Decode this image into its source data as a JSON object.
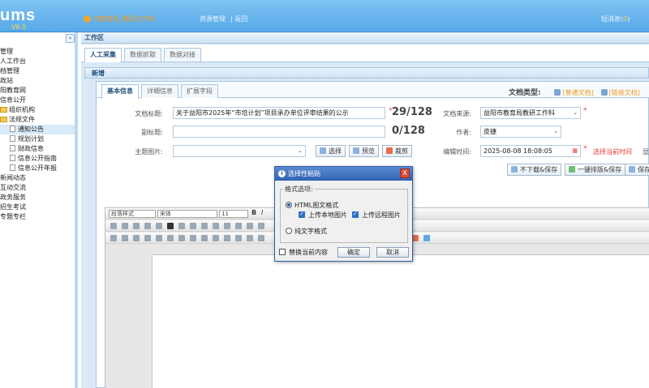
{
  "header": {
    "logo": "ums",
    "version": "V6.0",
    "user": "市教育局_教研工作科",
    "nav": [
      "资源管理",
      "返回"
    ],
    "msg_label": "短消息(",
    "msg_count": "0",
    "msg_close": ")"
  },
  "sidebar": {
    "collapse": "«",
    "items": [
      {
        "label": "管理",
        "type": "text"
      },
      {
        "label": "人工作台",
        "type": "text"
      },
      {
        "label": "档管理",
        "type": "text"
      },
      {
        "label": "政站",
        "type": "text"
      },
      {
        "label": "阳教育网",
        "type": "text"
      },
      {
        "label": "信息公开",
        "type": "text"
      },
      {
        "label": "组织机构",
        "type": "folder"
      },
      {
        "label": "法规文件",
        "type": "folder"
      },
      {
        "label": "通知公告",
        "type": "doc",
        "active": true
      },
      {
        "label": "规划计划",
        "type": "doc"
      },
      {
        "label": "财政信息",
        "type": "doc"
      },
      {
        "label": "信息公开指南",
        "type": "doc"
      },
      {
        "label": "信息公开年报",
        "type": "doc"
      },
      {
        "label": "新闻动态",
        "type": "text"
      },
      {
        "label": "互动交流",
        "type": "text"
      },
      {
        "label": "政务服务",
        "type": "text"
      },
      {
        "label": "招生考试",
        "type": "text"
      },
      {
        "label": "专题专栏",
        "type": "text"
      }
    ]
  },
  "work": {
    "title": "工作区",
    "tabs": [
      "人工采集",
      "数据抓取",
      "数据对接"
    ],
    "subbar": "新增"
  },
  "form": {
    "tabs": [
      "基本信息",
      "详细信息",
      "扩展字段"
    ],
    "doc_type_label": "文档类型:",
    "doc_types": [
      "[普通文档]",
      "[链接文档]"
    ],
    "title_label": "文档标题:",
    "title_value": "关于益阳市2025年“市培计划”项目承办单位评审结果的公示",
    "title_counter": "29/128",
    "subtitle_label": "副标题:",
    "subtitle_counter": "0/128",
    "image_label": "主题图片:",
    "image_buttons": [
      "选择",
      "预览",
      "裁剪"
    ],
    "source_label": "文档来源:",
    "source_value": "益阳市教育局教研工作科",
    "author_label": "作者:",
    "author_value": "皮捷",
    "time_label": "编辑时间:",
    "time_value": "2025-08-08 18:08:05",
    "time_hint": "选择当前时间",
    "time_extra": "显",
    "actions": [
      "不下载&保存",
      "一键排版&保存",
      "保存"
    ],
    "required_mark": "*"
  },
  "editor": {
    "paragraph_style": "段落样式",
    "font": "宋体",
    "size": "11",
    "bold": "B",
    "italic": "I"
  },
  "dialog": {
    "title": "选择性粘贴",
    "info": "i",
    "close": "X",
    "group_label": "格式选项:",
    "option_html": "HTML图文格式",
    "check_local": "上传本地图片",
    "check_remote": "上传远程图片",
    "option_text": "纯文字格式",
    "replace_label": "替换当前内容",
    "ok": "确定",
    "cancel": "取消"
  },
  "colors": {
    "header_blue": "#56a9e8",
    "accent_orange": "#f29a1e",
    "dialog_title": "#2e63b4"
  }
}
